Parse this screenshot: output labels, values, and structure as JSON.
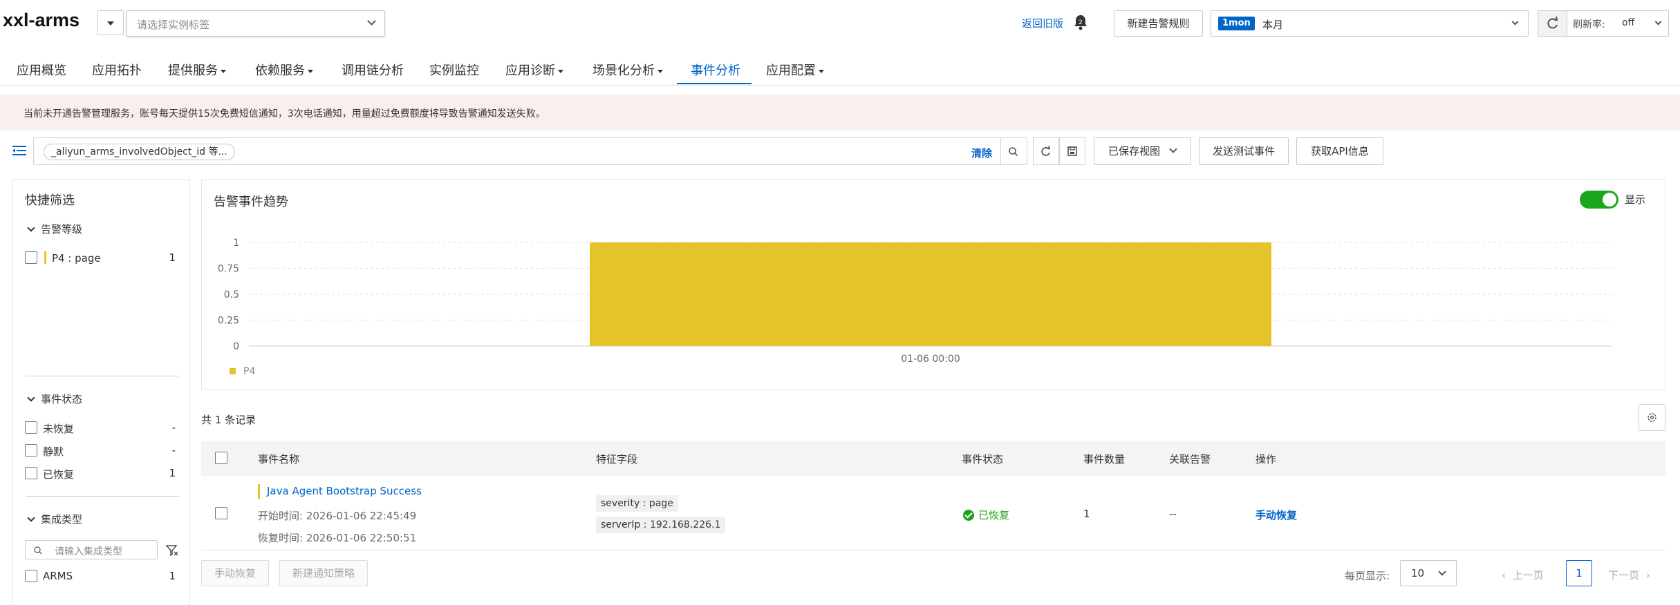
{
  "header": {
    "app_title": "xxl-arms",
    "instance_tag_placeholder": "请选择实例标签",
    "back_old_link": "返回旧版",
    "new_alert_rule_button": "新建告警规则",
    "time_range_tag": "1mon",
    "time_range_label": "本月",
    "refresh_rate_label": "刷新率:",
    "refresh_rate_value": "off"
  },
  "nav": {
    "tabs": [
      {
        "label": "应用概览"
      },
      {
        "label": "应用拓扑"
      },
      {
        "label": "提供服务"
      },
      {
        "label": "依赖服务"
      },
      {
        "label": "调用链分析"
      },
      {
        "label": "实例监控"
      },
      {
        "label": "应用诊断"
      },
      {
        "label": "场景化分析"
      },
      {
        "label": "事件分析"
      },
      {
        "label": "应用配置"
      }
    ],
    "active_tab": "事件分析"
  },
  "banner": {
    "text": "当前未开通告警管理服务，账号每天提供15次免费短信通知，3次电话通知，用量超过免费额度将导致告警通知发送失败。"
  },
  "search": {
    "chip": "_aliyun_arms_involvedObject_id 等...",
    "clear_label": "清除",
    "saved_views_label": "已保存视图",
    "send_test_event_button": "发送测试事件",
    "get_api_info_button": "获取API信息"
  },
  "filters": {
    "title": "快捷筛选",
    "groups": [
      {
        "title": "告警等级",
        "options": [
          {
            "label": "P4 : page",
            "count": "1"
          }
        ]
      },
      {
        "title": "事件状态",
        "options": [
          {
            "label": "未恢复",
            "count": "-"
          },
          {
            "label": "静默",
            "count": "-"
          },
          {
            "label": "已恢复",
            "count": "1"
          }
        ]
      },
      {
        "title": "集成类型",
        "search_placeholder": "请输入集成类型",
        "options": [
          {
            "label": "ARMS",
            "count": "1"
          }
        ]
      }
    ]
  },
  "chart_card": {
    "title": "告警事件趋势",
    "toggle_label": "显示",
    "toggle_on": true
  },
  "chart_data": {
    "type": "bar",
    "title": "告警事件趋势",
    "categories": [
      "01-06 00:00"
    ],
    "series": [
      {
        "name": "P4",
        "values": [
          1
        ],
        "color": "#e4c42a"
      }
    ],
    "yticks": [
      "0",
      "0.25",
      "0.5",
      "0.75",
      "1"
    ],
    "ylim": [
      0,
      1
    ],
    "grid": true,
    "legend_position": "bottom-left"
  },
  "table": {
    "record_count_text": "共 1 条记录",
    "columns": [
      "事件名称",
      "特征字段",
      "事件状态",
      "事件数量",
      "关联告警",
      "操作"
    ],
    "rows": [
      {
        "event_name": "Java Agent Bootstrap Success",
        "start_time": "开始时间: 2026-01-06 22:45:49",
        "recover_time": "恢复时间: 2026-01-06 22:50:51",
        "fields": [
          "severity : page",
          "serverIp : 192.168.226.1"
        ],
        "status": "已恢复",
        "count": "1",
        "related_alert": "--",
        "action": "手动恢复"
      }
    ]
  },
  "footer": {
    "manual_recover_button": "手动恢复",
    "new_notify_policy_button": "新建通知策略",
    "page_size_label": "每页显示:",
    "page_size_value": "10",
    "prev_label": "上一页",
    "next_label": "下一页",
    "current_page": "1"
  },
  "colors": {
    "accent": "#0064c8",
    "p4": "#e4c42a",
    "success": "#1aa61a",
    "banner_bg": "#f9f0ee"
  }
}
